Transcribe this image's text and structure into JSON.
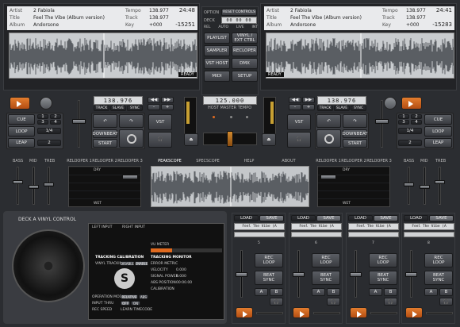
{
  "deck_left": {
    "artist_label": "Artist",
    "artist": "2 Fabiola",
    "title_label": "Title",
    "title": "Feel The Vibe (Album version)",
    "album_label": "Album",
    "album": "Andorsone",
    "tempo_label": "Tempo",
    "tempo": "138.977",
    "track_label": "Track",
    "track": "138.977",
    "key_label": "Key",
    "key": "+000",
    "time_elapsed": "24:48",
    "time_remaining": "-15251",
    "ready": "READY",
    "bpm": "138.976",
    "track_btn": "TRACK",
    "slave_btn": "SLAVE",
    "sync_btn": "SYNC",
    "cue": "CUE",
    "loop": "LOOP",
    "leap": "LEAP",
    "start": "START",
    "downbeat": "DOWNBEAT",
    "vst": "VST",
    "pad_numbers": [
      "1",
      "2",
      "3",
      "4",
      "1/4",
      "2"
    ]
  },
  "deck_right": {
    "artist_label": "Artist",
    "artist": "2 Fabiola",
    "title_label": "Title",
    "title": "Feel The Vibe (Album version)",
    "album_label": "Album",
    "album": "Andorsone",
    "tempo_label": "Tempo",
    "tempo": "138.977",
    "track_label": "Track",
    "track": "138.977",
    "key_label": "Key",
    "key": "+000",
    "time_elapsed": "24:41",
    "time_remaining": "-15283",
    "ready": "READY",
    "bpm": "138.976",
    "track_btn": "TRACK",
    "slave_btn": "SLAVE",
    "sync_btn": "SYNC",
    "cue": "CUE",
    "loop": "LOOP",
    "leap": "LEAP",
    "start": "START",
    "downbeat": "DOWNBEAT",
    "vst": "VST",
    "pad_numbers": [
      "1",
      "2",
      "3",
      "4",
      "1/4",
      "2"
    ]
  },
  "center": {
    "option": "OPTION",
    "reset": "RESET CONTROLS",
    "deck": "DECK",
    "deck_val": "00 00 00",
    "modes": [
      "REL",
      "AUTO",
      "LIVE",
      "INT"
    ],
    "buttons": [
      "PLAYLIST",
      "VINYL / EXT CTRL",
      "SAMPLER",
      "RECLOPER",
      "VST HOST",
      "DMX",
      "MIDI",
      "SETUP"
    ],
    "master_tempo": "125.000",
    "master_label": "HOST MASTER TEMPO"
  },
  "fx": {
    "left_eq": [
      "BASS",
      "MID",
      "TREB"
    ],
    "right_eq": [
      "BASS",
      "MID",
      "TREB"
    ],
    "left_tabs": [
      "RELOOPER 1",
      "RELOOPER 2",
      "RELOOPER 3"
    ],
    "right_tabs": [
      "RELOOPER 1",
      "RELOOPER 2",
      "RELOOPER 3"
    ],
    "scope_tabs": [
      "PEAKSCOPE",
      "SPECSCOPE",
      "HELP",
      "ABOUT"
    ],
    "dry": "DRY",
    "wet": "WET"
  },
  "vinyl": {
    "title": "DECK A VINYL CONTROL",
    "left_input": "LEFT INPUT",
    "right_input": "RIGHT INPUT",
    "vu": "VU METER",
    "tracking_cal": "TRACKING CALIBRATION",
    "tracking_mon": "TRACKING MONITOR",
    "vinyl_tracking": "VINYL TRACKING",
    "disable": "DISABLE",
    "enable": "ENABLE",
    "error_metric": "ERROR METRIC",
    "velocity": "VELOCITY",
    "velocity_val": "0.000",
    "signal_power": "SIGNAL POWER",
    "signal_val": "0.000",
    "abs_position": "ABS POSITION",
    "abs_val": "00:00.00",
    "calibration": "CALIBRATION",
    "operation_mode": "OPERATION MODE",
    "relative": "RELATIVE",
    "abs": "ABS",
    "input_thru": "INPUT THRU",
    "off": "OFF",
    "on": "ON",
    "rec_speed": "REC SPEED",
    "learn_timecode": "LEARN TIMECODE"
  },
  "samplers": [
    {
      "load": "LOAD",
      "save": "SAVE",
      "title": "Feel The Vibe (A",
      "num": "5",
      "rec": "REC",
      "loop": "LOOP",
      "beat": "BEAT",
      "sync": "SYNC",
      "a": "A",
      "b": "B"
    },
    {
      "load": "LOAD",
      "save": "SAVE",
      "title": "Feel The Vibe (A",
      "num": "6",
      "rec": "REC",
      "loop": "LOOP",
      "beat": "BEAT",
      "sync": "SYNC",
      "a": "A",
      "b": "B"
    },
    {
      "load": "LOAD",
      "save": "SAVE",
      "title": "Feel The Vibe (A",
      "num": "7",
      "rec": "REC",
      "loop": "LOOP",
      "beat": "BEAT",
      "sync": "SYNC",
      "a": "A",
      "b": "B"
    },
    {
      "load": "LOAD",
      "save": "SAVE",
      "title": "Feel The Vibe (A",
      "num": "8",
      "rec": "REC",
      "loop": "LOOP",
      "beat": "BEAT",
      "sync": "SYNC",
      "a": "A",
      "b": "B"
    }
  ],
  "colors": {
    "accent": "#e06a1f",
    "bg": "#2b2d31",
    "lcd": "#d9dbdd"
  }
}
